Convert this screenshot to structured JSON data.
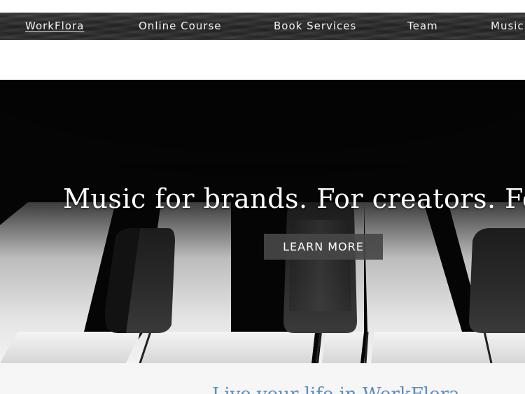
{
  "nav": {
    "brand": "WorkFlora",
    "links": [
      "Online Course",
      "Book Services",
      "Team",
      "Music"
    ]
  },
  "hero": {
    "title": "Music for brands. For creators. For",
    "cta_label": "LEARN MORE"
  },
  "section": {
    "heading": "Live your life in WorkFlora"
  },
  "colors": {
    "nav_bg": "#2c2c2c",
    "hero_bg": "#050505",
    "cta_bg": "#464646",
    "heading": "#5b8fc0"
  }
}
